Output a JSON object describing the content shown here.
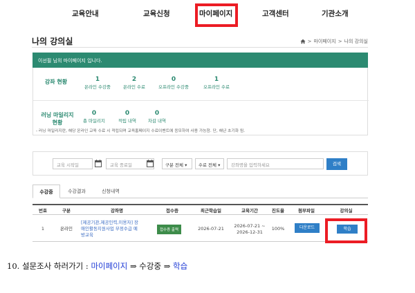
{
  "nav": {
    "items": [
      "교육안내",
      "교육신청",
      "마이페이지",
      "고객센터",
      "기관소개"
    ]
  },
  "page": {
    "title": "나의 강의실",
    "breadcrumb": [
      "마이페이지",
      "나의 강의실"
    ]
  },
  "banner": {
    "text": "이선필 님의 마이페이지 입니다."
  },
  "status": {
    "course_label": "강좌 현황",
    "course_stats": [
      {
        "value": "1",
        "label": "온라인 수강중"
      },
      {
        "value": "2",
        "label": "온라인 수료"
      },
      {
        "value": "0",
        "label": "오프라인 수강중"
      },
      {
        "value": "1",
        "label": "오프라인 수료"
      }
    ],
    "mileage_label_1": "러닝 마일리지",
    "mileage_label_2": "현황",
    "mileage_stats": [
      {
        "value": "0",
        "label": "총 마일리지"
      },
      {
        "value": "0",
        "label": "적립 내역"
      },
      {
        "value": "0",
        "label": "차감 내역"
      }
    ],
    "note": "- 러닝 마일리지란, 해당 온라인 교육 수료 시 적립되며 교육홈페이지 수료이벤트에 응모하여 사용 가능함. 단, 해년 초기화 됨."
  },
  "search": {
    "start_placeholder": "교육 시작일",
    "end_placeholder": "교육 종료일",
    "type_select": "구분 전체",
    "complete_select": "수료 전체",
    "keyword_placeholder": "강좌명을 입력하세요",
    "search_label": "검색"
  },
  "tabs": [
    "수강중",
    "수강결과",
    "신청내역"
  ],
  "table": {
    "headers": [
      "번호",
      "구분",
      "강좌명",
      "접수증",
      "최근학습일",
      "교육기간",
      "진도율",
      "첨부파일",
      "강의실"
    ],
    "rows": [
      {
        "no": "1",
        "type": "온라인",
        "course_1": "[제공기관,제공인력,이용자] 장",
        "course_2": "애인활동지원사업 부정수급 예",
        "course_3": "방교육",
        "receipt": "접수증 출력",
        "last_study": "2026-07-21",
        "period_1": "2026-07-21 ~",
        "period_2": "2026-12-31",
        "progress": "100%",
        "attach": "다운로드",
        "classroom": "학습"
      }
    ]
  },
  "instruction": {
    "prefix": "10. 설문조사 하러가기 : ",
    "step1": "마이페이지",
    "arrow1": " ⇒ ",
    "step2": "수강중",
    "arrow2": " ⇒ ",
    "step3": "학습"
  },
  "colors": {
    "brand_green": "#2c8a71",
    "highlight_red": "#ec1c24",
    "button_blue": "#2f7fc7"
  }
}
